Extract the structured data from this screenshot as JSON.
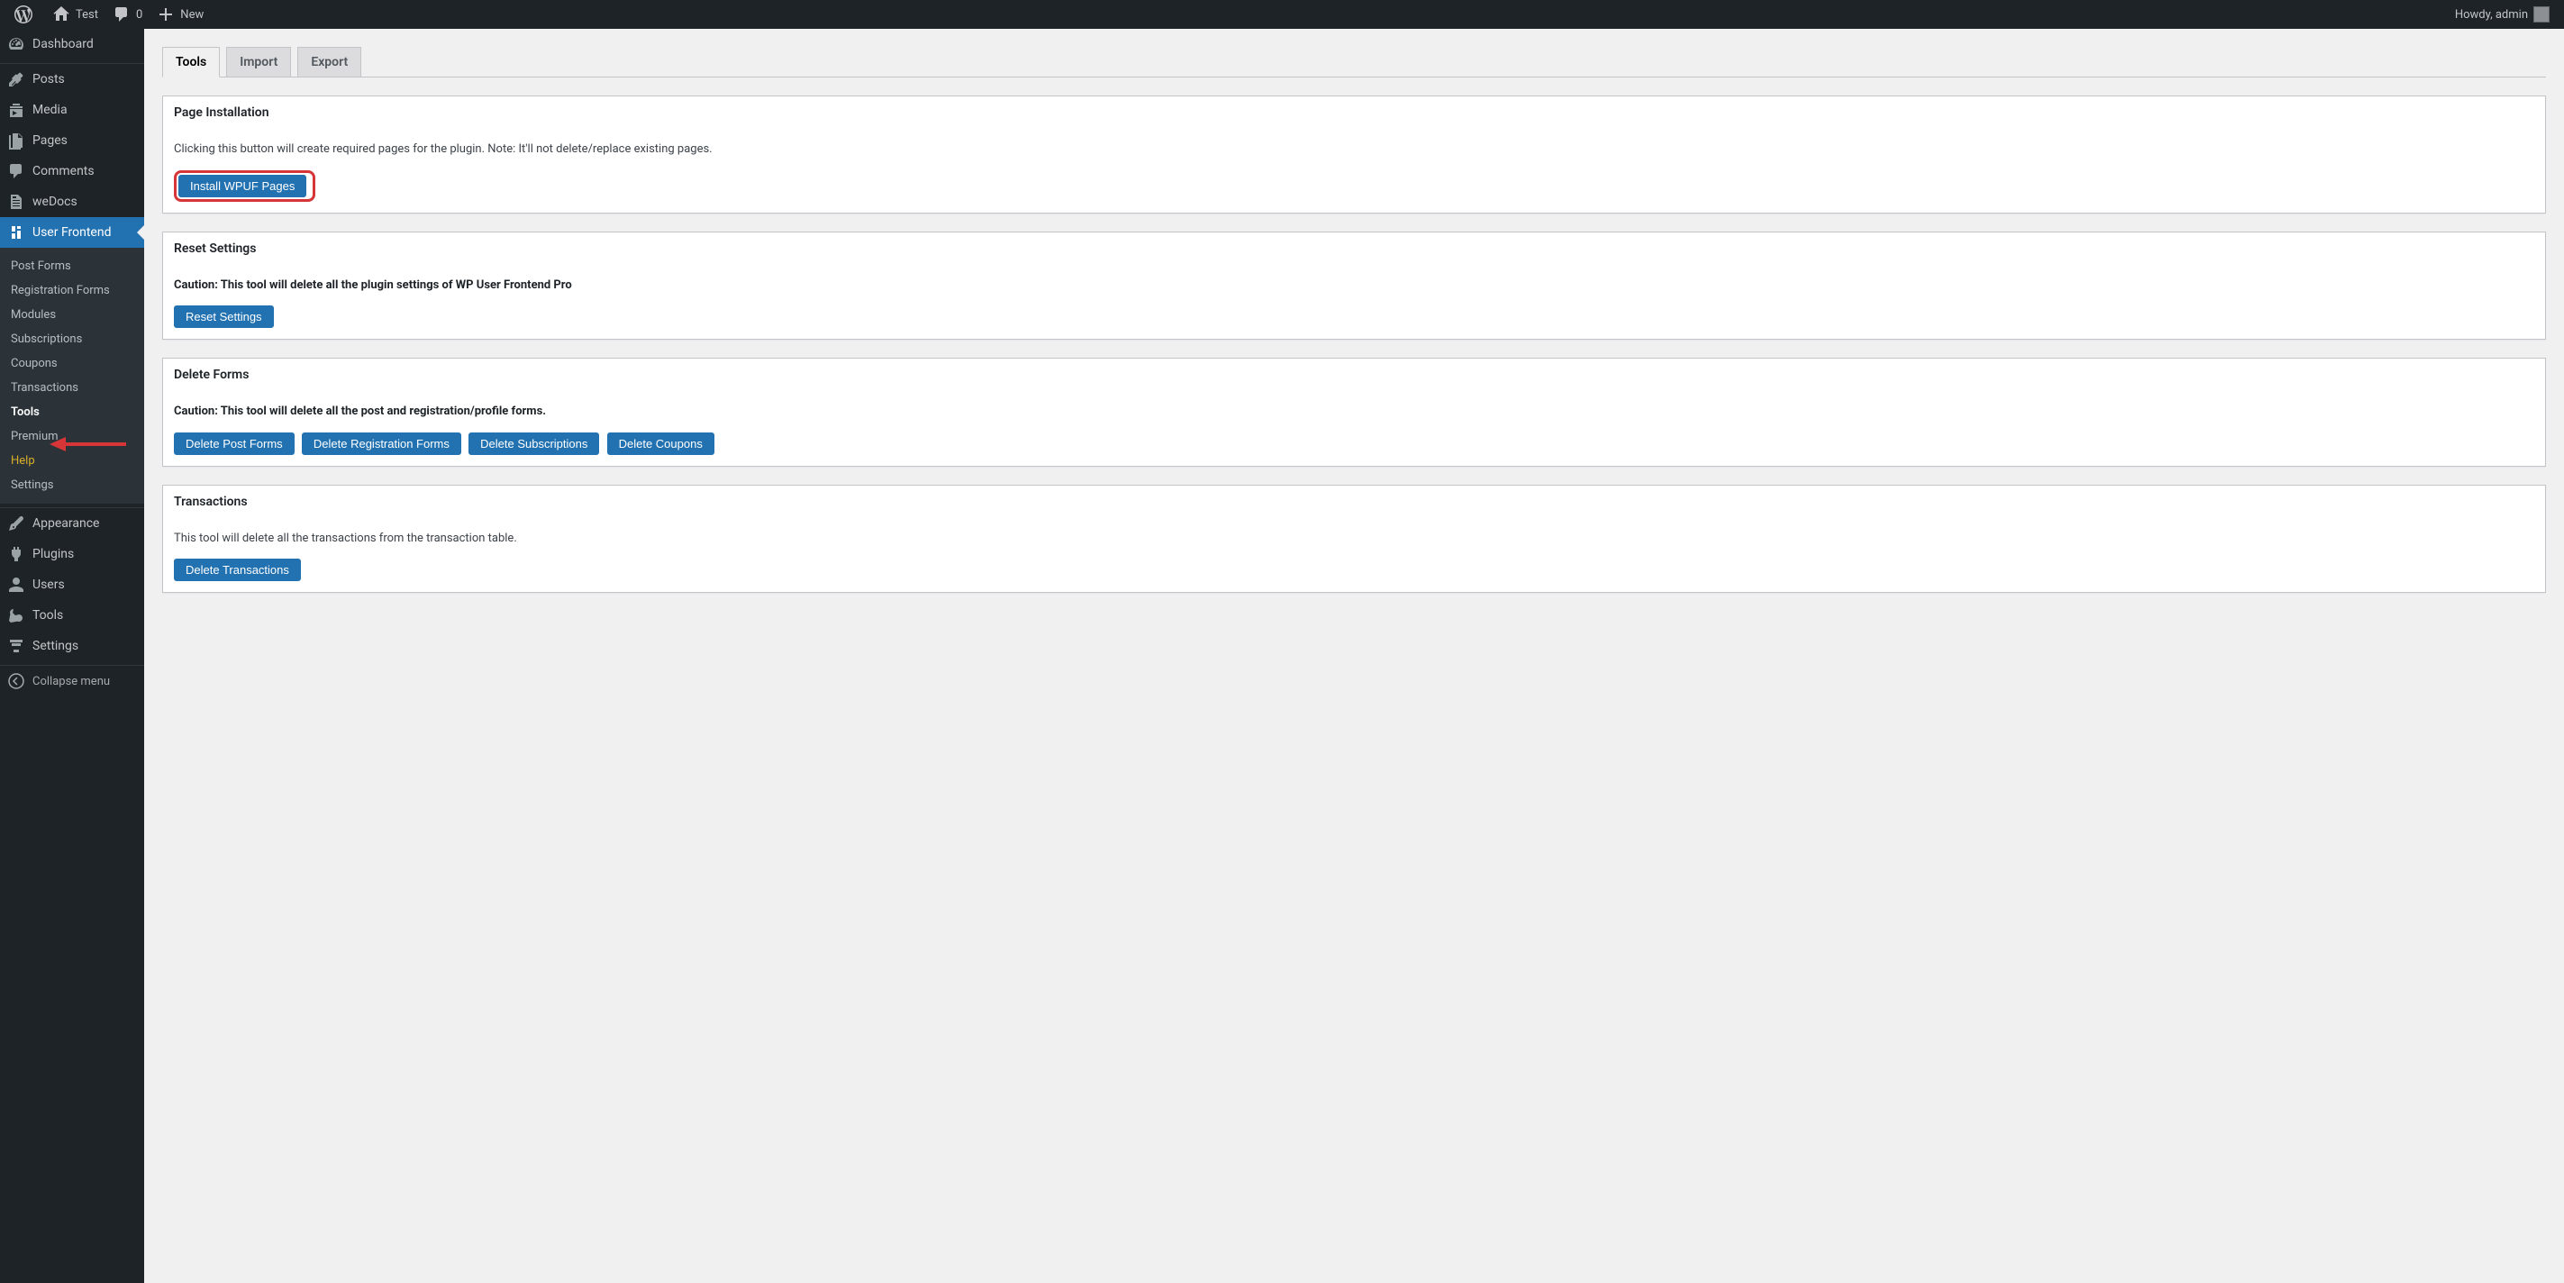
{
  "adminbar": {
    "site_name": "Test",
    "comments_count": "0",
    "new_label": "New",
    "howdy": "Howdy, admin"
  },
  "menu": {
    "dashboard": "Dashboard",
    "posts": "Posts",
    "media": "Media",
    "pages": "Pages",
    "comments": "Comments",
    "wedocs": "weDocs",
    "user_frontend": "User Frontend",
    "appearance": "Appearance",
    "plugins": "Plugins",
    "users": "Users",
    "tools": "Tools",
    "settings": "Settings",
    "collapse": "Collapse menu"
  },
  "submenu": {
    "post_forms": "Post Forms",
    "registration_forms": "Registration Forms",
    "modules": "Modules",
    "subscriptions": "Subscriptions",
    "coupons": "Coupons",
    "transactions": "Transactions",
    "tools": "Tools",
    "premium": "Premium",
    "help": "Help",
    "settings": "Settings"
  },
  "tabs": {
    "tools": "Tools",
    "import": "Import",
    "export": "Export"
  },
  "sections": {
    "page_install": {
      "title": "Page Installation",
      "desc": "Clicking this button will create required pages for the plugin. Note: It'll not delete/replace existing pages.",
      "button": "Install WPUF Pages"
    },
    "reset": {
      "title": "Reset Settings",
      "desc": "Caution: This tool will delete all the plugin settings of WP User Frontend Pro",
      "button": "Reset Settings"
    },
    "delete_forms": {
      "title": "Delete Forms",
      "desc": "Caution: This tool will delete all the post and registration/profile forms.",
      "btn_post": "Delete Post Forms",
      "btn_reg": "Delete Registration Forms",
      "btn_subs": "Delete Subscriptions",
      "btn_coup": "Delete Coupons"
    },
    "transactions": {
      "title": "Transactions",
      "desc": "This tool will delete all the transactions from the transaction table.",
      "button": "Delete Transactions"
    }
  },
  "colors": {
    "accent": "#2271b1",
    "highlight": "#d63638"
  }
}
